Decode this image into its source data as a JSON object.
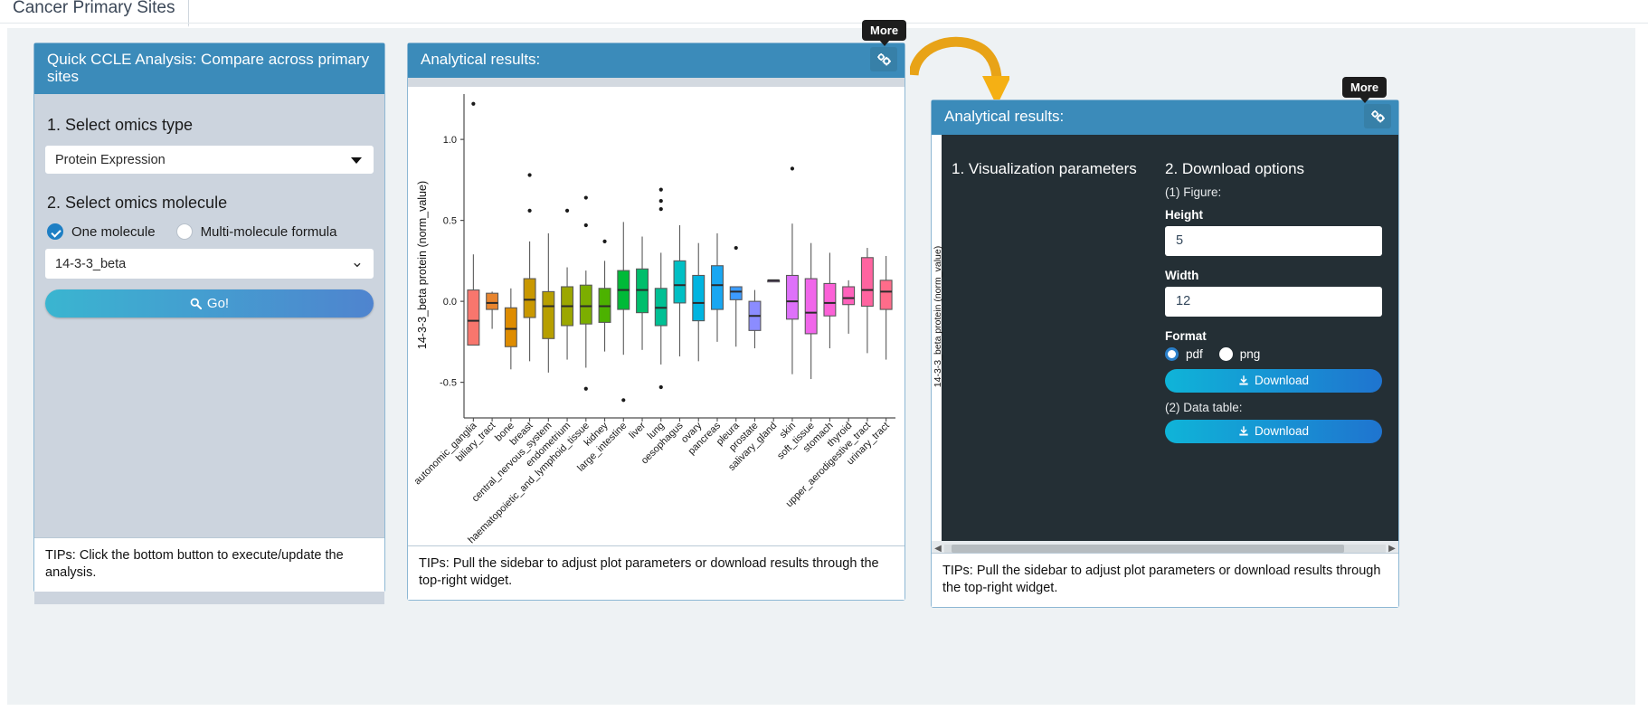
{
  "tab": {
    "label": "Cancer Primary Sites"
  },
  "left_panel": {
    "title": "Quick CCLE Analysis: Compare across primary sites",
    "step1_title": "1. Select omics type",
    "omics_type_value": "Protein Expression",
    "step2_title": "2. Select omics molecule",
    "radio_one": "One molecule",
    "radio_multi": "Multi-molecule formula",
    "molecule_value": "14-3-3_beta",
    "go_label": "Go!",
    "go_icon": "search-icon",
    "tips": "TIPs: Click the bottom button to execute/update the analysis."
  },
  "mid_panel": {
    "title": "Analytical results:",
    "gear_icon": "gears-icon",
    "tooltip": "More",
    "tips": "TIPs: Pull the sidebar to adjust plot parameters or download results through the top-right widget."
  },
  "right_panel": {
    "title": "Analytical results:",
    "gear_icon": "gears-icon",
    "tooltip": "More",
    "col1_title": "1. Visualization parameters",
    "col2_title": "2. Download options",
    "figure_label": "(1) Figure:",
    "height_label": "Height",
    "height_value": "5",
    "width_label": "Width",
    "width_value": "12",
    "format_label": "Format",
    "format_pdf": "pdf",
    "format_png": "png",
    "format_selected": "pdf",
    "download_figure_label": "Download",
    "datatable_label": "(2) Data table:",
    "download_table_label": "Download",
    "download_icon": "download-icon",
    "tips": "TIPs: Pull the sidebar to adjust plot parameters or download results through the top-right widget."
  },
  "chart_data": {
    "type": "boxplot",
    "title": "",
    "xlabel": "",
    "ylabel": "14-3-3_beta protein (norm_value)",
    "ylim": [
      -0.72,
      1.28
    ],
    "yticks": [
      -0.5,
      0.0,
      0.5,
      1.0
    ],
    "ytick_labels": [
      "-0.5",
      "0.0",
      "0.5",
      "1.0"
    ],
    "grid": false,
    "legend": "none",
    "categories": [
      "autonomic_ganglia",
      "biliary_tract",
      "bone",
      "breast",
      "central_nervous_system",
      "endometrium",
      "haematopoietic_and_lymphoid_tissue",
      "kidney",
      "large_intestine",
      "liver",
      "lung",
      "oesophagus",
      "ovary",
      "pancreas",
      "pleura",
      "prostate",
      "salivary_gland",
      "skin",
      "soft_tissue",
      "stomach",
      "thyroid",
      "upper_aerodigestive_tract",
      "urinary_tract"
    ],
    "colors": [
      "#F8766D",
      "#E8852F",
      "#DE8C00",
      "#C99800",
      "#B79F00",
      "#9CA700",
      "#7CAE00",
      "#4CB200",
      "#00BA38",
      "#00BE6C",
      "#00C094",
      "#00BFC4",
      "#00B4E0",
      "#19A7F2",
      "#3C9BFF",
      "#8B8CFF",
      "#C77CFF",
      "#DE71F9",
      "#F066EA",
      "#FB61D7",
      "#FF62BC",
      "#FF64A0",
      "#FF6C8A"
    ],
    "boxes": [
      {
        "cat": "autonomic_ganglia",
        "lower": -0.27,
        "q1": -0.27,
        "median": -0.12,
        "q3": 0.07,
        "upper": 0.29,
        "outliers": [
          1.22
        ]
      },
      {
        "cat": "biliary_tract",
        "lower": -0.17,
        "q1": -0.05,
        "median": -0.01,
        "q3": 0.05,
        "upper": 0.06,
        "outliers": []
      },
      {
        "cat": "bone",
        "lower": -0.42,
        "q1": -0.28,
        "median": -0.17,
        "q3": -0.04,
        "upper": 0.08,
        "outliers": []
      },
      {
        "cat": "breast",
        "lower": -0.37,
        "q1": -0.1,
        "median": 0.01,
        "q3": 0.14,
        "upper": 0.37,
        "outliers": [
          0.78,
          0.56
        ]
      },
      {
        "cat": "central_nervous_system",
        "lower": -0.44,
        "q1": -0.23,
        "median": -0.03,
        "q3": 0.06,
        "upper": 0.42,
        "outliers": []
      },
      {
        "cat": "endometrium",
        "lower": -0.36,
        "q1": -0.15,
        "median": -0.03,
        "q3": 0.09,
        "upper": 0.21,
        "outliers": [
          0.56
        ]
      },
      {
        "cat": "haematopoietic_and_lymphoid_tissue",
        "lower": -0.41,
        "q1": -0.14,
        "median": -0.03,
        "q3": 0.1,
        "upper": 0.19,
        "outliers": [
          0.64,
          0.47,
          -0.54
        ]
      },
      {
        "cat": "kidney",
        "lower": -0.31,
        "q1": -0.13,
        "median": -0.03,
        "q3": 0.08,
        "upper": 0.25,
        "outliers": [
          0.37
        ]
      },
      {
        "cat": "large_intestine",
        "lower": -0.33,
        "q1": -0.05,
        "median": 0.07,
        "q3": 0.19,
        "upper": 0.49,
        "outliers": [
          -0.61
        ]
      },
      {
        "cat": "liver",
        "lower": -0.3,
        "q1": -0.07,
        "median": 0.07,
        "q3": 0.2,
        "upper": 0.4,
        "outliers": []
      },
      {
        "cat": "lung",
        "lower": -0.39,
        "q1": -0.15,
        "median": -0.04,
        "q3": 0.08,
        "upper": 0.3,
        "outliers": [
          0.69,
          0.62,
          0.57,
          -0.53
        ]
      },
      {
        "cat": "oesophagus",
        "lower": -0.34,
        "q1": -0.01,
        "median": 0.1,
        "q3": 0.25,
        "upper": 0.47,
        "outliers": []
      },
      {
        "cat": "ovary",
        "lower": -0.37,
        "q1": -0.12,
        "median": -0.01,
        "q3": 0.16,
        "upper": 0.36,
        "outliers": []
      },
      {
        "cat": "pancreas",
        "lower": -0.25,
        "q1": -0.05,
        "median": 0.1,
        "q3": 0.22,
        "upper": 0.42,
        "outliers": []
      },
      {
        "cat": "pleura",
        "lower": -0.28,
        "q1": 0.01,
        "median": 0.06,
        "q3": 0.09,
        "upper": 0.09,
        "outliers": [
          0.33
        ]
      },
      {
        "cat": "prostate",
        "lower": -0.29,
        "q1": -0.18,
        "median": -0.09,
        "q3": 0.0,
        "upper": 0.07,
        "outliers": []
      },
      {
        "cat": "salivary_gland",
        "lower": 0.12,
        "q1": 0.12,
        "median": 0.13,
        "q3": 0.13,
        "upper": 0.13,
        "outliers": []
      },
      {
        "cat": "skin",
        "lower": -0.45,
        "q1": -0.11,
        "median": 0.0,
        "q3": 0.16,
        "upper": 0.48,
        "outliers": [
          0.82
        ]
      },
      {
        "cat": "soft_tissue",
        "lower": -0.48,
        "q1": -0.2,
        "median": -0.07,
        "q3": 0.14,
        "upper": 0.36,
        "outliers": []
      },
      {
        "cat": "stomach",
        "lower": -0.29,
        "q1": -0.09,
        "median": -0.01,
        "q3": 0.11,
        "upper": 0.3,
        "outliers": []
      },
      {
        "cat": "thyroid",
        "lower": -0.2,
        "q1": -0.02,
        "median": 0.02,
        "q3": 0.09,
        "upper": 0.13,
        "outliers": []
      },
      {
        "cat": "upper_aerodigestive_tract",
        "lower": -0.32,
        "q1": -0.03,
        "median": 0.07,
        "q3": 0.27,
        "upper": 0.33,
        "outliers": []
      },
      {
        "cat": "urinary_tract",
        "lower": -0.36,
        "q1": -0.05,
        "median": 0.06,
        "q3": 0.13,
        "upper": 0.28,
        "outliers": []
      }
    ]
  }
}
